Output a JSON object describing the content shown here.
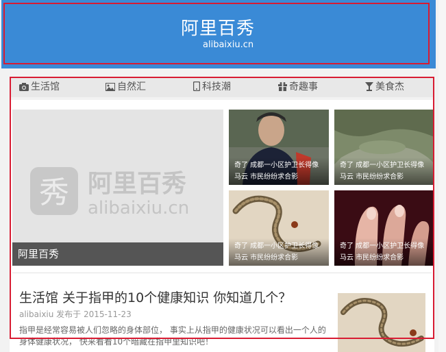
{
  "header": {
    "brand_cn": "阿里百秀",
    "brand_en": "alibaixiu.cn",
    "color": "#3a8ad6"
  },
  "nav": {
    "items": [
      {
        "label": "生活馆",
        "icon": "camera-icon"
      },
      {
        "label": "自然汇",
        "icon": "image-icon"
      },
      {
        "label": "科技潮",
        "icon": "mobile-icon"
      },
      {
        "label": "奇趣事",
        "icon": "gift-icon"
      },
      {
        "label": "美食杰",
        "icon": "cocktail-icon"
      }
    ]
  },
  "hero": {
    "logo_cn": "阿里百秀",
    "logo_en": "alibaixiu.cn",
    "logo_mark": "秀",
    "caption": "阿里百秀"
  },
  "thumbs": [
    {
      "line1": "奇了 成都一小区护卫长得像",
      "line2": "马云 市民纷纷求合影"
    },
    {
      "line1": "奇了 成都一小区护卫长得像",
      "line2": "马云 市民纷纷求合影"
    },
    {
      "line1": "奇了 成都一小区护卫长得像",
      "line2": "马云 市民纷纷求合影"
    },
    {
      "line1": "奇了 成都一小区护卫长得像",
      "line2": "马云 市民纷纷求合影"
    }
  ],
  "article": {
    "title": "生活馆 关于指甲的10个健康知识 你知道几个？",
    "meta": "alibaixiu 发布于 2015-11-23",
    "desc": "指甲是经常容易被人们忽略的身体部位， 事实上从指甲的健康状况可以看出一个人的身体健康状况， 快来看看10个暗藏在指甲里知识吧！"
  }
}
